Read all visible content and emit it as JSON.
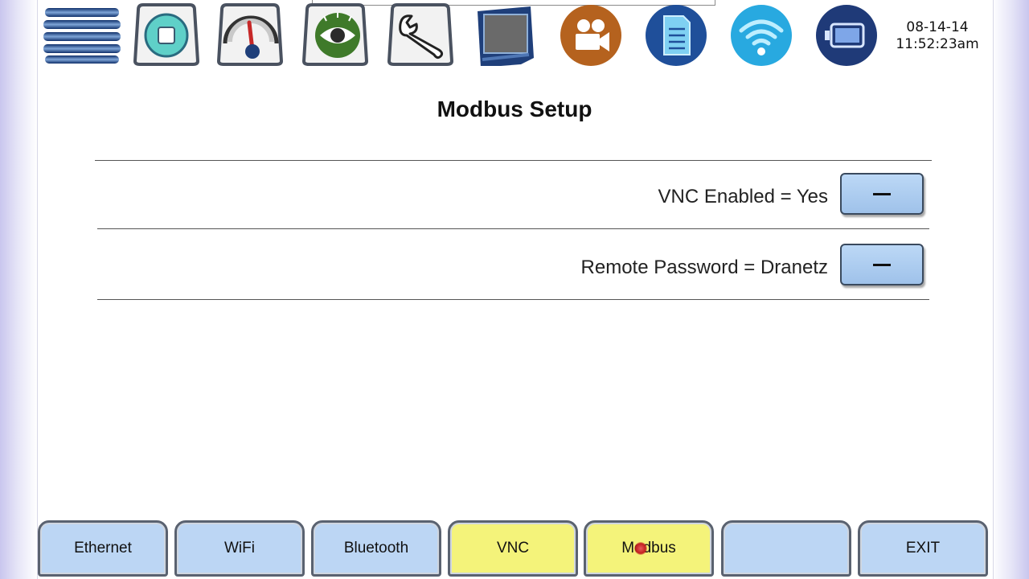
{
  "header": {
    "date": "08-14-14",
    "time": "11:52:23am",
    "icons": [
      "dranetz-logo-icon",
      "stop-icon",
      "gauge-icon",
      "eye-icon",
      "wrench-icon",
      "monitor-icon",
      "video-camera-icon",
      "document-icon",
      "wifi-icon",
      "battery-icon"
    ]
  },
  "page": {
    "title": "Modbus Setup"
  },
  "settings": [
    {
      "label": "VNC Enabled = Yes"
    },
    {
      "label": "Remote Password = Dranetz"
    }
  ],
  "tabs": [
    {
      "label": "Ethernet",
      "state": "normal"
    },
    {
      "label": "WiFi",
      "state": "normal"
    },
    {
      "label": "Bluetooth",
      "state": "normal"
    },
    {
      "label": "VNC",
      "state": "highlighted"
    },
    {
      "label": "Modbus",
      "state": "highlighted"
    },
    {
      "label": "",
      "state": "normal"
    },
    {
      "label": "EXIT",
      "state": "normal"
    }
  ],
  "colors": {
    "tab_blue": "#bcd6f4",
    "tab_yellow": "#f4f37a",
    "button_blue": "#a9cbee",
    "brand_navy": "#1f3f7a"
  }
}
